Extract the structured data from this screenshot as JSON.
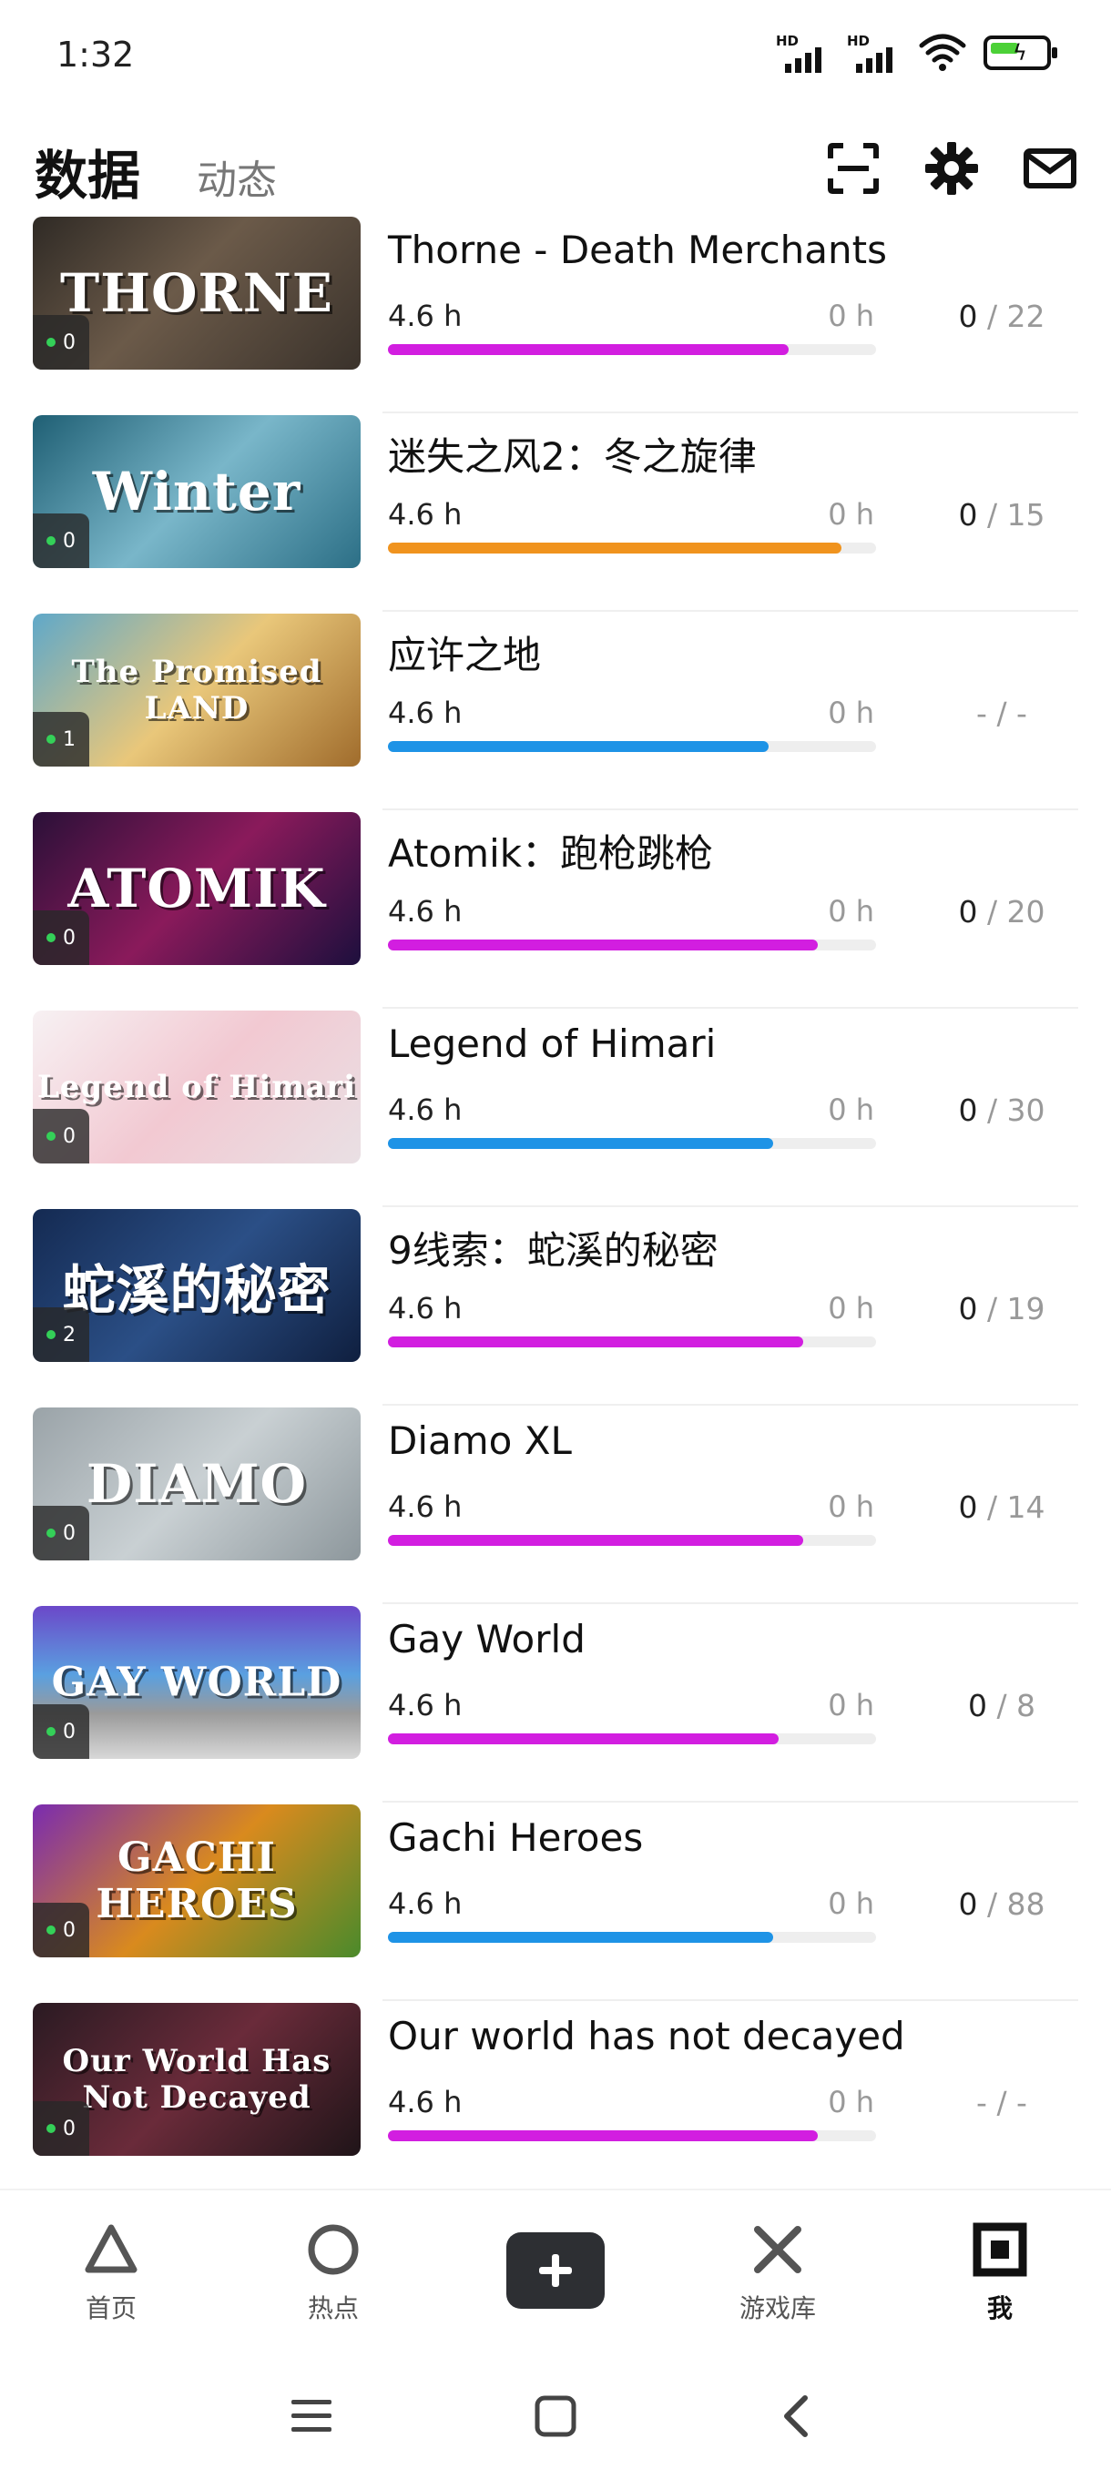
{
  "status_bar": {
    "time": "1:32",
    "signal_label_1": "HD",
    "signal_label_2": "HD"
  },
  "header": {
    "tab_active": "数据",
    "tab_inactive": "动态",
    "icons": [
      "scan-icon",
      "gear-icon",
      "mail-icon"
    ]
  },
  "games": [
    {
      "name": "Thorne - Death Merchants",
      "hours": "4.6 h",
      "zero": "0 h",
      "progress_pct": 82,
      "bar_color": "#d21ee0",
      "ach_done": "0",
      "ach_total": " / 22",
      "thumb_text": "THORNE",
      "badge_count": "0",
      "thumb_bg": "linear-gradient(135deg,#2f2a25 0%,#6b5a49 45%,#3a322b 100%)"
    },
    {
      "name": "迷失之风2：冬之旋律",
      "hours": "4.6 h",
      "zero": "0 h",
      "progress_pct": 93,
      "bar_color": "#f0931e",
      "ach_done": "0",
      "ach_total": " / 15",
      "thumb_text": "Winter",
      "badge_count": "0",
      "thumb_bg": "linear-gradient(135deg,#1f5f74 0%,#79b6c9 50%,#2c6f86 100%)"
    },
    {
      "name": "应许之地",
      "hours": "4.6 h",
      "zero": "0 h",
      "progress_pct": 78,
      "bar_color": "#1e93e6",
      "ach_done": "-",
      "ach_total": " / -",
      "thumb_text": "The Promised LAND",
      "badge_count": "1",
      "thumb_bg": "linear-gradient(135deg,#5fa8c9 0%,#e9c77a 50%,#a06c2c 100%)"
    },
    {
      "name": "Atomik：跑枪跳枪",
      "hours": "4.6 h",
      "zero": "0 h",
      "progress_pct": 88,
      "bar_color": "#d21ee0",
      "ach_done": "0",
      "ach_total": " / 20",
      "thumb_text": "ATOMIK",
      "badge_count": "0",
      "thumb_bg": "linear-gradient(135deg,#2a1038 0%,#8a1a5b 50%,#1d0f3d 100%)"
    },
    {
      "name": "Legend of Himari",
      "hours": "4.6 h",
      "zero": "0 h",
      "progress_pct": 79,
      "bar_color": "#1e93e6",
      "ach_done": "0",
      "ach_total": " / 30",
      "thumb_text": "Legend of Himari",
      "badge_count": "0",
      "thumb_bg": "linear-gradient(135deg,#f7f1f3 0%,#f2c9d2 50%,#e9e0e4 100%)"
    },
    {
      "name": "9线索：蛇溪的秘密",
      "hours": "4.6 h",
      "zero": "0 h",
      "progress_pct": 85,
      "bar_color": "#d21ee0",
      "ach_done": "0",
      "ach_total": " / 19",
      "thumb_text": "蛇溪的秘密",
      "badge_count": "2",
      "thumb_bg": "linear-gradient(135deg,#142a52 0%,#2b4f86 50%,#0f1f3f 100%)"
    },
    {
      "name": "Diamo XL",
      "hours": "4.6 h",
      "zero": "0 h",
      "progress_pct": 85,
      "bar_color": "#d21ee0",
      "ach_done": "0",
      "ach_total": " / 14",
      "thumb_text": "DIAMO",
      "badge_count": "0",
      "thumb_bg": "linear-gradient(135deg,#9aa3a8 0%,#c9d0d3 50%,#8d979c 100%)"
    },
    {
      "name": "Gay World",
      "hours": "4.6 h",
      "zero": "0 h",
      "progress_pct": 80,
      "bar_color": "#d21ee0",
      "ach_done": "0",
      "ach_total": " / 8",
      "thumb_text": "GAY WORLD",
      "badge_count": "0",
      "thumb_bg": "linear-gradient(180deg,#6b48c9 0%,#5aa0e0 45%,#9a9a9a 70%,#d8d8d8 100%)"
    },
    {
      "name": "Gachi Heroes",
      "hours": "4.6 h",
      "zero": "0 h",
      "progress_pct": 79,
      "bar_color": "#1e93e6",
      "ach_done": "0",
      "ach_total": " / 88",
      "thumb_text": "GACHI HEROES",
      "badge_count": "0",
      "thumb_bg": "linear-gradient(135deg,#7a2bb0 0%,#d98a1e 50%,#4a8a2b 100%)"
    },
    {
      "name": "Our world has not decayed",
      "hours": "4.6 h",
      "zero": "0 h",
      "progress_pct": 88,
      "bar_color": "#d21ee0",
      "ach_done": "-",
      "ach_total": " / -",
      "thumb_text": "Our World Has Not Decayed",
      "badge_count": "0",
      "thumb_bg": "linear-gradient(135deg,#2a1a22 0%,#6a2b3a 50%,#1f1418 100%)"
    }
  ],
  "bottom_nav": {
    "home": "首页",
    "hot": "热点",
    "library": "游戏库",
    "me": "我"
  }
}
